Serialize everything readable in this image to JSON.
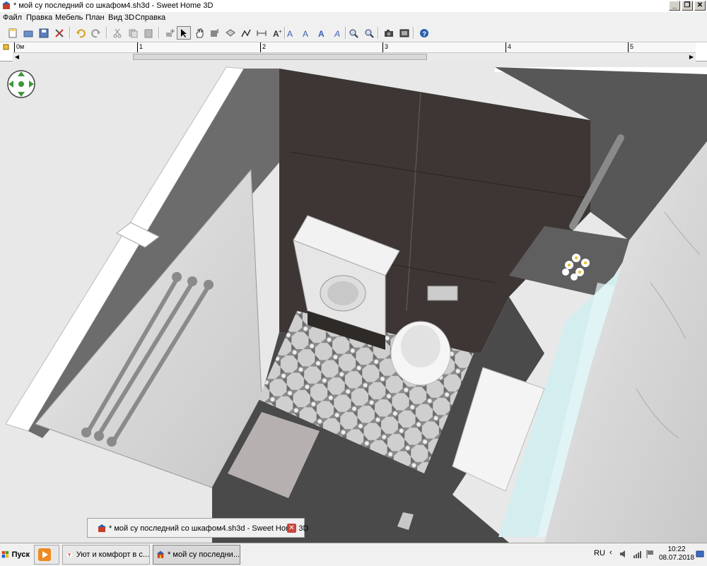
{
  "window": {
    "title": "* мой су последний со шкафом4.sh3d - Sweet Home 3D",
    "minimize": "_",
    "restore": "❐",
    "close": "✕"
  },
  "menu": {
    "items": [
      "Файл",
      "Правка",
      "Мебель",
      "План",
      "Вид 3D",
      "Справка"
    ]
  },
  "toolbar": {
    "buttons": [
      "new-home",
      "open",
      "save",
      "cut-preferences",
      "undo",
      "redo",
      "cut",
      "copy",
      "paste",
      "add-furniture",
      "select",
      "pan",
      "create-walls",
      "create-rooms",
      "create-polylines",
      "create-dimensions",
      "add-text",
      "modify-text-style",
      "increase-text-size",
      "decrease-text-size",
      "bold-text",
      "italic-text",
      "zoom-in",
      "zoom-out",
      "create-photo",
      "create-video",
      "help"
    ]
  },
  "ruler": {
    "labels": [
      "0м",
      "1",
      "2",
      "3",
      "4",
      "5"
    ]
  },
  "float_window": {
    "title": "* мой су последний со шкафом4.sh3d - Sweet Home 3D",
    "close": "✕"
  },
  "taskbar": {
    "start_label": "Пуск",
    "tasks": [
      {
        "label": "",
        "icon": "media-player-icon"
      },
      {
        "label": "Уют и комфорт в с...",
        "icon": "yandex-browser-icon"
      },
      {
        "label": "* мой су последни...",
        "icon": "sweet-home-3d-icon"
      }
    ],
    "language": "RU",
    "time": "10:22",
    "date": "08.07.2018"
  },
  "colors": {
    "accent": "#316ac5",
    "floor_dark": "#4a4a4a",
    "tile_dark": "#3d3634",
    "wall_light": "#e8e8e8"
  }
}
